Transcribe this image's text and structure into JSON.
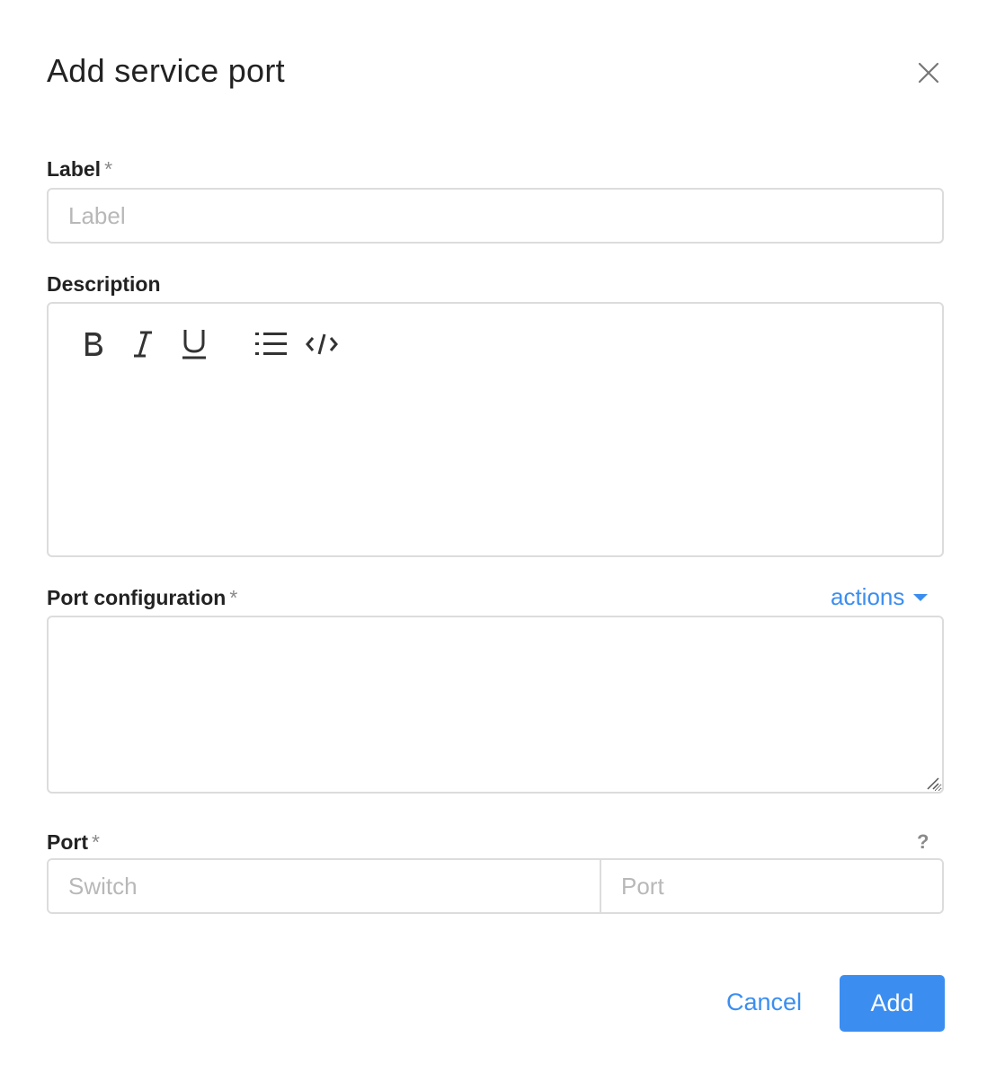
{
  "dialog": {
    "title": "Add service port",
    "close_icon": "close-icon"
  },
  "fields": {
    "label": {
      "label": "Label",
      "required_mark": "*",
      "value": "",
      "placeholder": "Label"
    },
    "description": {
      "label": "Description",
      "toolbar": [
        "bold-icon",
        "italic-icon",
        "underline-icon",
        "bulleted-list-icon",
        "code-icon"
      ],
      "value": ""
    },
    "port_configuration": {
      "label": "Port configuration",
      "required_mark": "*",
      "actions_label": "actions",
      "value": ""
    },
    "port": {
      "label": "Port",
      "required_mark": "*",
      "help": "?",
      "switch_placeholder": "Switch",
      "port_placeholder": "Port"
    }
  },
  "footer": {
    "cancel_label": "Cancel",
    "add_label": "Add"
  },
  "colors": {
    "accent": "#3b8ef0",
    "border": "#dcdcdc",
    "placeholder": "#b8b8b8",
    "muted": "#8a8a8a"
  }
}
